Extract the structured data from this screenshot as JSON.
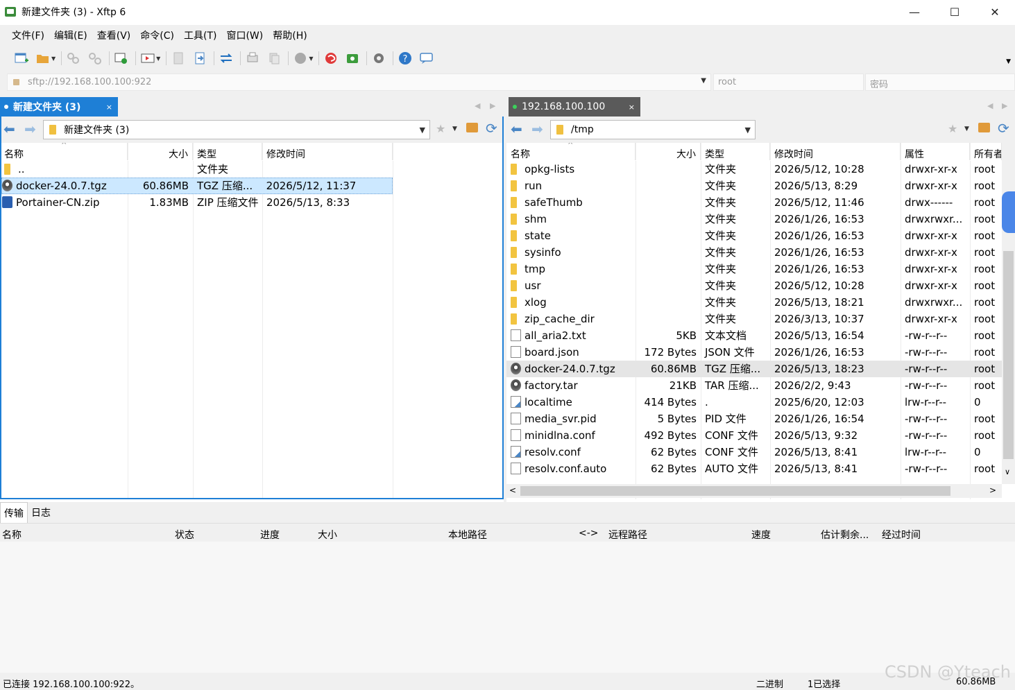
{
  "window": {
    "title": "新建文件夹 (3) - Xftp 6",
    "minimize": "—",
    "maximize": "☐",
    "close": "✕"
  },
  "menu": [
    "文件(F)",
    "编辑(E)",
    "查看(V)",
    "命令(C)",
    "工具(T)",
    "窗口(W)",
    "帮助(H)"
  ],
  "address": {
    "host": "sftp://192.168.100.100:922",
    "user": "root",
    "password": "密码"
  },
  "left_tab": {
    "label": "新建文件夹 (3)",
    "close": "×"
  },
  "right_tab": {
    "label": "192.168.100.100",
    "close": "×"
  },
  "left_pane": {
    "path": "新建文件夹 (3)",
    "columns": [
      "名称",
      "大小",
      "类型",
      "修改时间"
    ],
    "rows": [
      {
        "name": "..",
        "size": "",
        "type": "文件夹",
        "mtime": ""
      },
      {
        "name": "docker-24.0.7.tgz",
        "size": "60.86MB",
        "type": "TGZ 压缩...",
        "mtime": "2026/5/12, 11:37"
      },
      {
        "name": "Portainer-CN.zip",
        "size": "1.83MB",
        "type": "ZIP 压缩文件",
        "mtime": "2026/5/13, 8:33"
      }
    ]
  },
  "right_pane": {
    "path": "/tmp",
    "columns": [
      "名称",
      "大小",
      "类型",
      "修改时间",
      "属性",
      "所有者"
    ],
    "rows": [
      {
        "name": "opkg-lists",
        "size": "",
        "type": "文件夹",
        "mtime": "2026/5/12, 10:28",
        "attr": "drwxr-xr-x",
        "owner": "root"
      },
      {
        "name": "run",
        "size": "",
        "type": "文件夹",
        "mtime": "2026/5/13, 8:29",
        "attr": "drwxr-xr-x",
        "owner": "root"
      },
      {
        "name": "safeThumb",
        "size": "",
        "type": "文件夹",
        "mtime": "2026/5/12, 11:46",
        "attr": "drwx------",
        "owner": "root"
      },
      {
        "name": "shm",
        "size": "",
        "type": "文件夹",
        "mtime": "2026/1/26, 16:53",
        "attr": "drwxrwxr...",
        "owner": "root"
      },
      {
        "name": "state",
        "size": "",
        "type": "文件夹",
        "mtime": "2026/1/26, 16:53",
        "attr": "drwxr-xr-x",
        "owner": "root"
      },
      {
        "name": "sysinfo",
        "size": "",
        "type": "文件夹",
        "mtime": "2026/1/26, 16:53",
        "attr": "drwxr-xr-x",
        "owner": "root"
      },
      {
        "name": "tmp",
        "size": "",
        "type": "文件夹",
        "mtime": "2026/1/26, 16:53",
        "attr": "drwxr-xr-x",
        "owner": "root"
      },
      {
        "name": "usr",
        "size": "",
        "type": "文件夹",
        "mtime": "2026/5/12, 10:28",
        "attr": "drwxr-xr-x",
        "owner": "root"
      },
      {
        "name": "xlog",
        "size": "",
        "type": "文件夹",
        "mtime": "2026/5/13, 18:21",
        "attr": "drwxrwxr...",
        "owner": "root"
      },
      {
        "name": "zip_cache_dir",
        "size": "",
        "type": "文件夹",
        "mtime": "2026/3/13, 10:37",
        "attr": "drwxr-xr-x",
        "owner": "root"
      },
      {
        "name": "all_aria2.txt",
        "size": "5KB",
        "type": "文本文档",
        "mtime": "2026/5/13, 16:54",
        "attr": "-rw-r--r--",
        "owner": "root"
      },
      {
        "name": "board.json",
        "size": "172 Bytes",
        "type": "JSON 文件",
        "mtime": "2026/1/26, 16:53",
        "attr": "-rw-r--r--",
        "owner": "root"
      },
      {
        "name": "docker-24.0.7.tgz",
        "size": "60.86MB",
        "type": "TGZ 压缩...",
        "mtime": "2026/5/13, 18:23",
        "attr": "-rw-r--r--",
        "owner": "root"
      },
      {
        "name": "factory.tar",
        "size": "21KB",
        "type": "TAR 压缩...",
        "mtime": "2026/2/2, 9:43",
        "attr": "-rw-r--r--",
        "owner": "root"
      },
      {
        "name": "localtime",
        "size": "414 Bytes",
        "type": ".",
        "mtime": "2025/6/20, 12:03",
        "attr": "lrw-r--r--",
        "owner": "0"
      },
      {
        "name": "media_svr.pid",
        "size": "5 Bytes",
        "type": "PID 文件",
        "mtime": "2026/1/26, 16:54",
        "attr": "-rw-r--r--",
        "owner": "root"
      },
      {
        "name": "minidlna.conf",
        "size": "492 Bytes",
        "type": "CONF 文件",
        "mtime": "2026/5/13, 9:32",
        "attr": "-rw-r--r--",
        "owner": "root"
      },
      {
        "name": "resolv.conf",
        "size": "62 Bytes",
        "type": "CONF 文件",
        "mtime": "2026/5/13, 8:41",
        "attr": "lrw-r--r--",
        "owner": "0"
      },
      {
        "name": "resolv.conf.auto",
        "size": "62 Bytes",
        "type": "AUTO 文件",
        "mtime": "2026/5/13, 8:41",
        "attr": "-rw-r--r--",
        "owner": "root"
      }
    ]
  },
  "bottom_tabs": [
    "传输",
    "日志"
  ],
  "transfer_columns": [
    "名称",
    "状态",
    "进度",
    "大小",
    "本地路径",
    "<->",
    "远程路径",
    "速度",
    "估计剩余...",
    "经过时间"
  ],
  "status": {
    "connection": "已连接 192.168.100.100:922。",
    "mode": "二进制",
    "selected": "1已选择",
    "size": "60.86MB"
  },
  "watermark": "CSDN @Yteach"
}
